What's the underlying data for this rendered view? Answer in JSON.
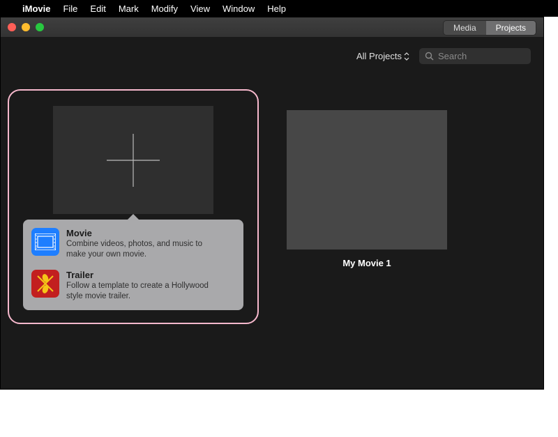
{
  "menubar": {
    "app": "iMovie",
    "items": [
      "File",
      "Edit",
      "Mark",
      "Modify",
      "View",
      "Window",
      "Help"
    ]
  },
  "titlebar": {
    "segments": {
      "media": "Media",
      "projects": "Projects"
    }
  },
  "toolbar": {
    "filter_label": "All Projects",
    "search_placeholder": "Search"
  },
  "popover": {
    "movie": {
      "title": "Movie",
      "desc": "Combine videos, photos, and music to make your own movie."
    },
    "trailer": {
      "title": "Trailer",
      "desc": "Follow a template to create a Hollywood style movie trailer."
    }
  },
  "project": {
    "title": "My Movie 1"
  }
}
